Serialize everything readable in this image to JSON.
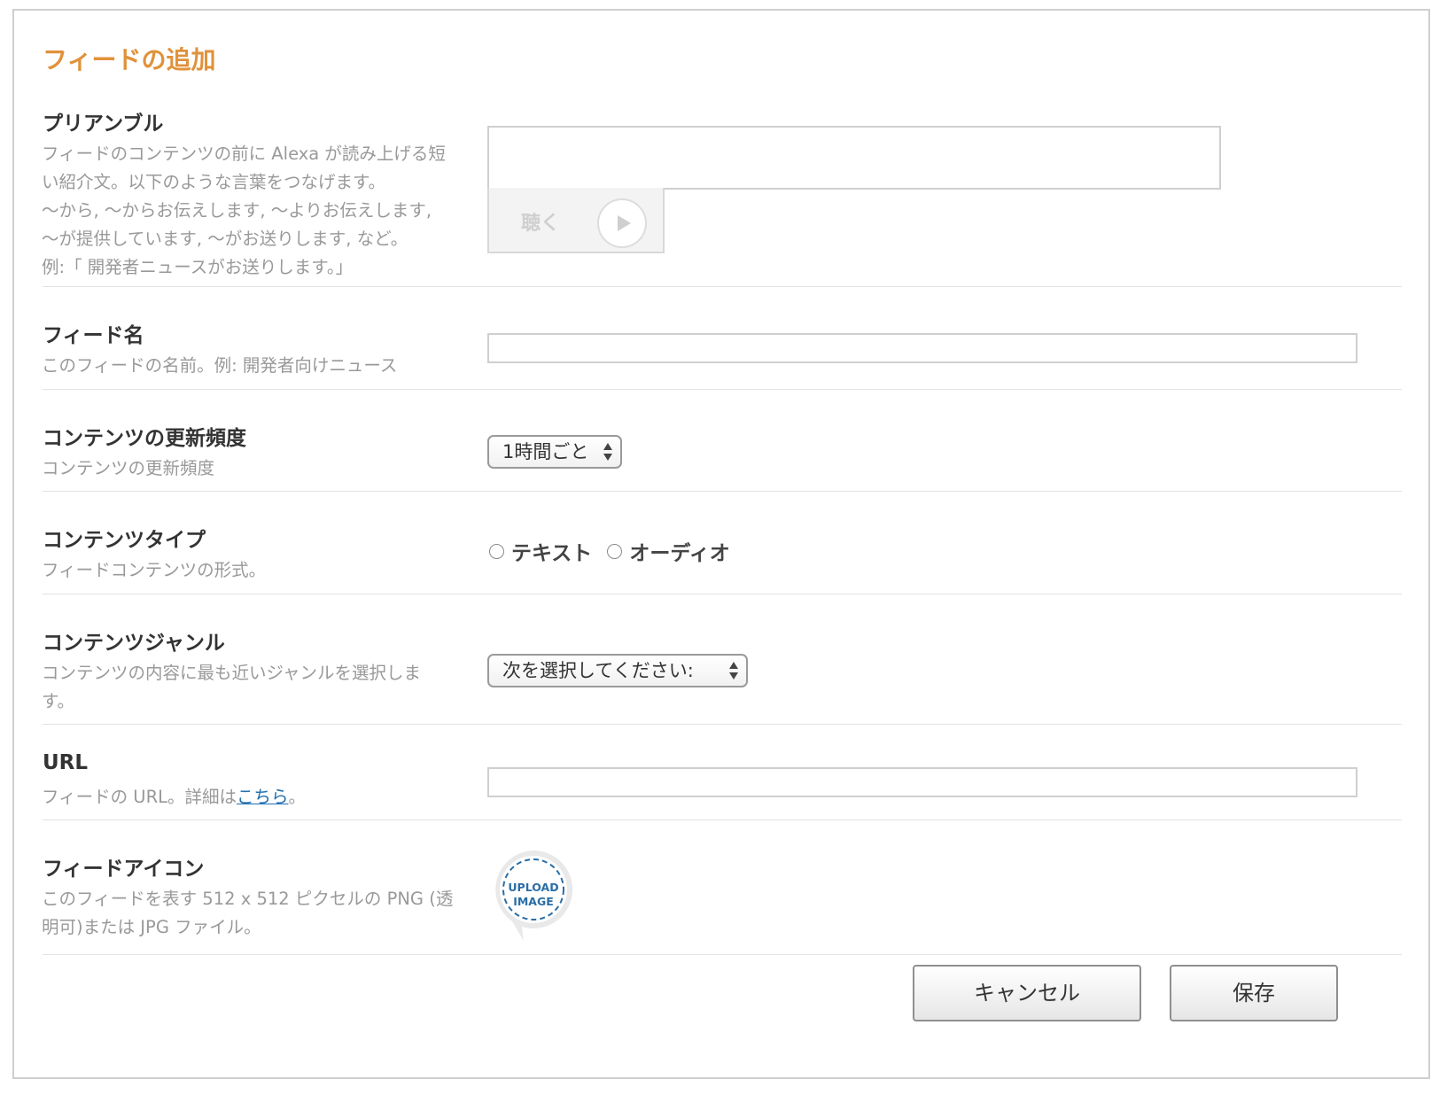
{
  "page_title": "フィードの追加",
  "preamble": {
    "label": "プリアンブル",
    "description_lines": [
      "フィードのコンテンツの前に Alexa が読み上げる短",
      "い紹介文。以下のような言葉をつなげます。",
      "〜から, 〜からお伝えします, 〜よりお伝えします,",
      "〜が提供しています, 〜がお送りします, など。",
      "例:「 開発者ニュースがお送りします。」"
    ],
    "value": "",
    "listen_label": "聴く",
    "play_icon": "play-icon"
  },
  "feed_name": {
    "label": "フィード名",
    "description": "このフィードの名前。例: 開発者向けニュース",
    "value": ""
  },
  "update_frequency": {
    "label": "コンテンツの更新頻度",
    "description": "コンテンツの更新頻度",
    "selected": "1時間ごと",
    "arrows_icon": "select-arrows-icon"
  },
  "content_type": {
    "label": "コンテンツタイプ",
    "description": "フィードコンテンツの形式。",
    "options": [
      "テキスト",
      "オーディオ"
    ],
    "selected_index": null
  },
  "content_genre": {
    "label": "コンテンツジャンル",
    "description_lines": [
      "コンテンツの内容に最も近いジャンルを選択しま",
      "す。"
    ],
    "selected": "次を選択してください:",
    "arrows_icon": "select-arrows-icon"
  },
  "url": {
    "label": "URL",
    "description_prefix": "フィードの URL。詳細は",
    "link_text": "こちら",
    "description_suffix": "。",
    "value": ""
  },
  "feed_icon": {
    "label": "フィードアイコン",
    "description_lines": [
      "このフィードを表す 512 x 512 ピクセルの PNG (透",
      "明可)または JPG ファイル。"
    ],
    "upload_line1": "UPLOAD",
    "upload_line2": "IMAGE",
    "icon": "speech-bubble-upload-icon"
  },
  "buttons": {
    "cancel": "キャンセル",
    "save": "保存"
  },
  "colors": {
    "title": "#e0923a",
    "link": "#1f6fb2",
    "upload_text": "#2a6ea6"
  }
}
